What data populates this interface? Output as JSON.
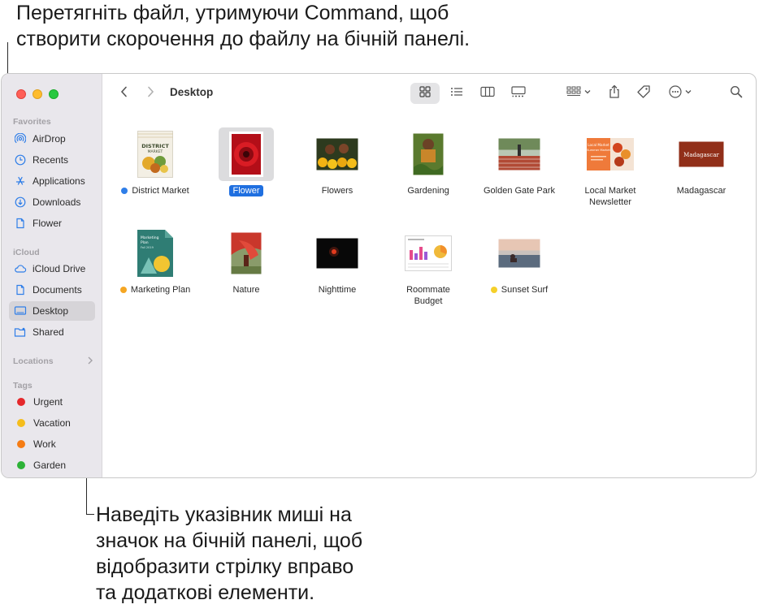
{
  "callouts": {
    "top_line1": "Перетягніть файл, утримуючи Command, щоб",
    "top_line2": "створити скорочення до файлу на бічній панелі.",
    "bottom_line1": "Наведіть указівник миші на",
    "bottom_line2": "значок на бічній панелі, щоб",
    "bottom_line3": "відобразити стрілку вправо",
    "bottom_line4": "та додаткові елементи."
  },
  "window": {
    "title": "Desktop"
  },
  "sidebar": {
    "favorites_header": "Favorites",
    "favorites": [
      {
        "label": "AirDrop",
        "icon": "airdrop-icon"
      },
      {
        "label": "Recents",
        "icon": "clock-icon"
      },
      {
        "label": "Applications",
        "icon": "applications-icon"
      },
      {
        "label": "Downloads",
        "icon": "download-icon"
      },
      {
        "label": "Flower",
        "icon": "document-icon"
      }
    ],
    "icloud_header": "iCloud",
    "icloud": [
      {
        "label": "iCloud Drive",
        "icon": "cloud-icon"
      },
      {
        "label": "Documents",
        "icon": "document-icon"
      },
      {
        "label": "Desktop",
        "icon": "desktop-icon",
        "selected": true
      },
      {
        "label": "Shared",
        "icon": "shared-folder-icon"
      }
    ],
    "locations_header": "Locations",
    "tags_header": "Tags",
    "tags": [
      {
        "label": "Urgent",
        "color": "#e5282b"
      },
      {
        "label": "Vacation",
        "color": "#f5bd1c"
      },
      {
        "label": "Work",
        "color": "#f57c14"
      },
      {
        "label": "Garden",
        "color": "#2db237"
      }
    ]
  },
  "toolbar": {
    "icons": [
      "back-icon",
      "forward-icon",
      "icon-view-icon",
      "list-view-icon",
      "column-view-icon",
      "gallery-view-icon",
      "group-icon",
      "share-icon",
      "tag-icon",
      "more-icon",
      "search-icon"
    ]
  },
  "files": [
    {
      "name": "District Market",
      "tag_color": "#2f7ee8"
    },
    {
      "name": "Flower",
      "selected": true
    },
    {
      "name": "Flowers"
    },
    {
      "name": "Gardening"
    },
    {
      "name": "Golden Gate Park"
    },
    {
      "name": "Local Market Newsletter"
    },
    {
      "name": "Madagascar"
    },
    {
      "name": "Marketing Plan",
      "tag_color": "#f5a623"
    },
    {
      "name": "Nature"
    },
    {
      "name": "Nighttime"
    },
    {
      "name": "Roommate Budget"
    },
    {
      "name": "Sunset Surf",
      "tag_color": "#f5d02a"
    }
  ],
  "thumb_text": {
    "district_line1": "DISTRICT",
    "district_line2": "MARKET",
    "marketing_line1": "Marketing",
    "marketing_line2": "Plan",
    "marketing_line3": "Fall 2019",
    "newsletter_line1": "Local Market",
    "newsletter_line2": "Summer Market",
    "madagascar": "Madagascar"
  }
}
